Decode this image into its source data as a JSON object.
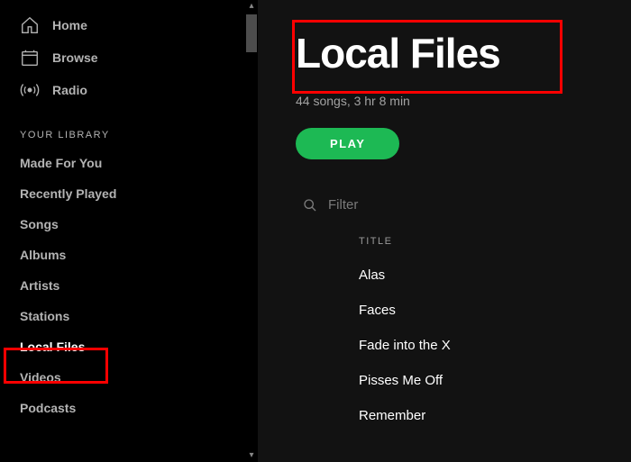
{
  "nav": {
    "home": "Home",
    "browse": "Browse",
    "radio": "Radio"
  },
  "library": {
    "header": "YOUR LIBRARY",
    "items": [
      {
        "label": "Made For You"
      },
      {
        "label": "Recently Played"
      },
      {
        "label": "Songs"
      },
      {
        "label": "Albums"
      },
      {
        "label": "Artists"
      },
      {
        "label": "Stations"
      },
      {
        "label": "Local Files"
      },
      {
        "label": "Videos"
      },
      {
        "label": "Podcasts"
      }
    ]
  },
  "main": {
    "title": "Local Files",
    "meta": "44 songs, 3 hr 8 min",
    "play": "PLAY",
    "filter_placeholder": "Filter",
    "column_title": "TITLE",
    "tracks": [
      {
        "title": "Alas"
      },
      {
        "title": "Faces"
      },
      {
        "title": "Fade into the X"
      },
      {
        "title": "Pisses Me Off"
      },
      {
        "title": "Remember"
      }
    ]
  }
}
